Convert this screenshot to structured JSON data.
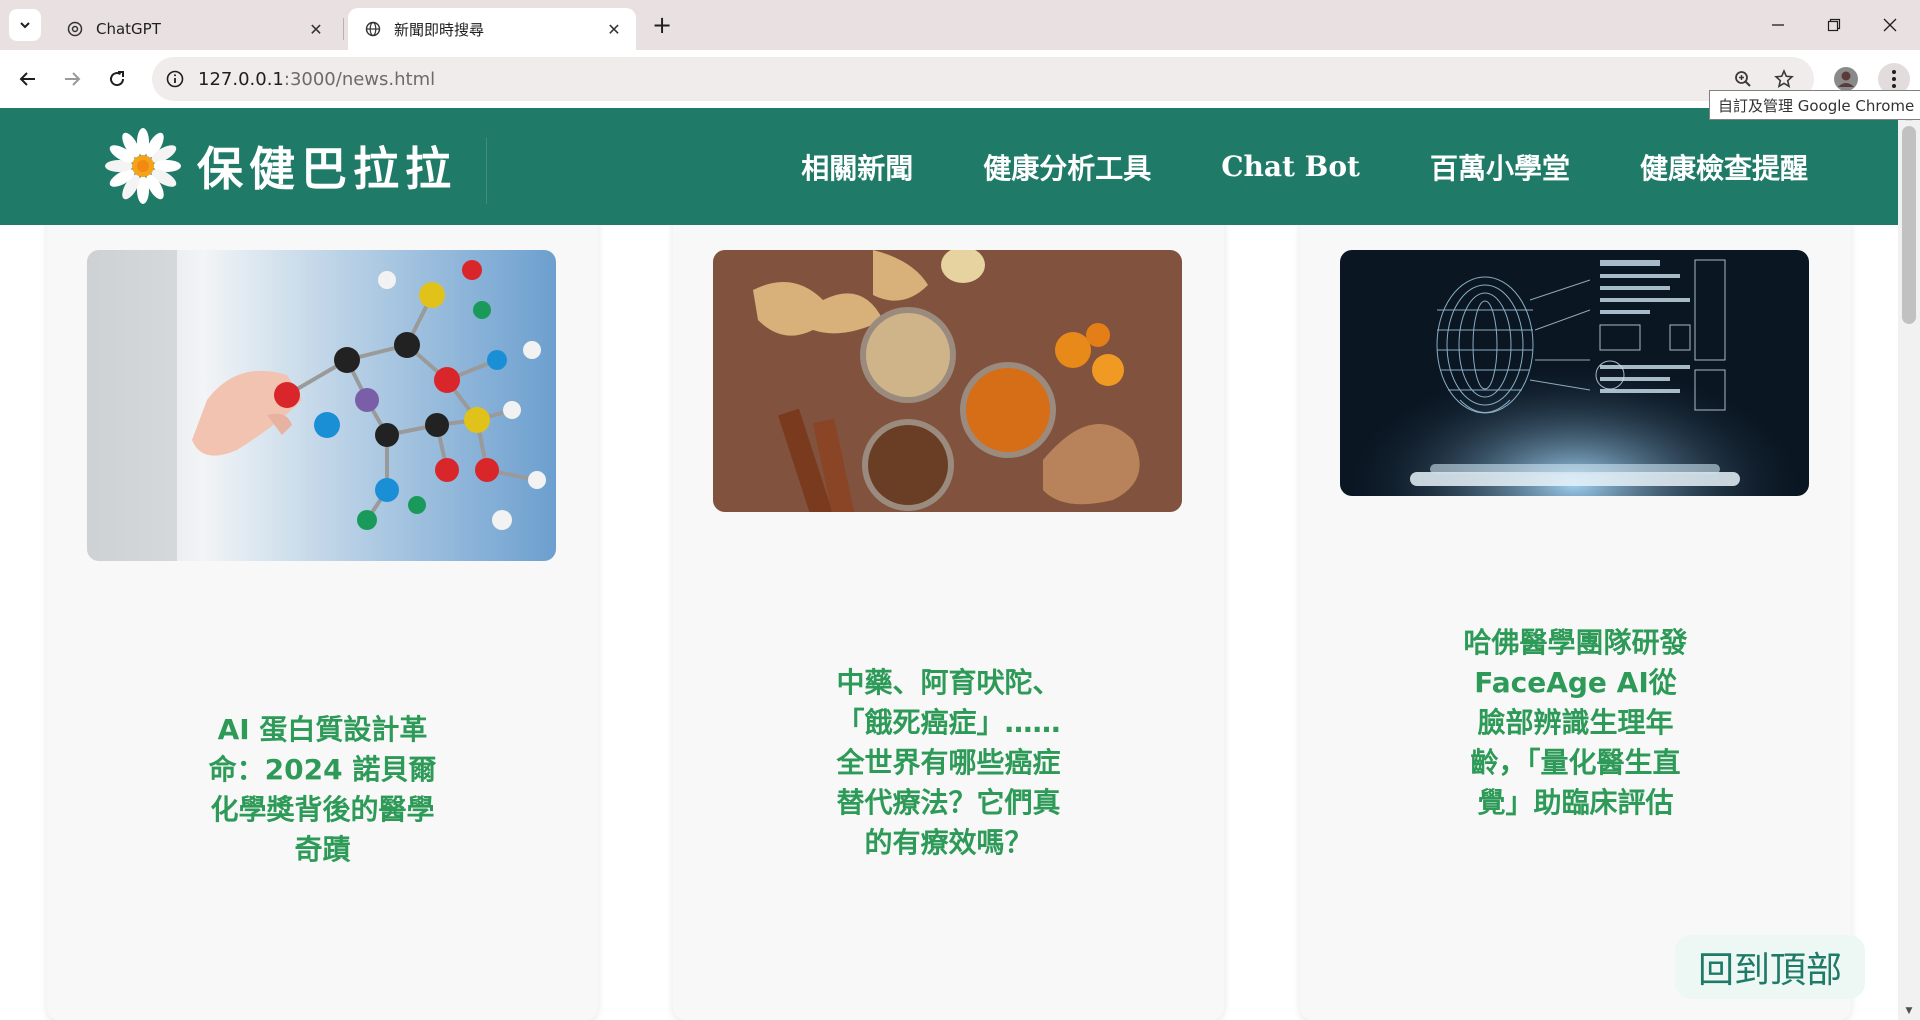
{
  "browser": {
    "tabs": [
      {
        "title": "ChatGPT",
        "icon": "chatgpt-icon",
        "active": false
      },
      {
        "title": "新聞即時搜尋",
        "icon": "globe-icon",
        "active": true
      }
    ],
    "address": {
      "host": "127.0.0.1",
      "path": ":3000/news.html"
    },
    "tooltip": "自訂及管理 Google Chrome"
  },
  "site": {
    "logo_text": "保健巴拉拉",
    "nav": [
      "相關新聞",
      "健康分析工具",
      "Chat Bot",
      "百萬小學堂",
      "健康檢查提醒"
    ]
  },
  "cards": [
    {
      "headline": "AI 蛋白質設計革命：2024 諾貝爾化學獎背後的醫學奇蹟",
      "image": "molecule-model-photo"
    },
    {
      "headline": "中藥、阿育吠陀、「餓死癌症」……全世界有哪些癌症替代療法？它們真的有療效嗎？",
      "image": "spices-photo"
    },
    {
      "headline": "哈佛醫學團隊研發FaceAge AI從臉部辨識生理年齡，「量化醫生直覺」助臨床評估",
      "image": "ai-face-hologram-photo"
    }
  ],
  "back_to_top": "回到頂部",
  "colors": {
    "header": "#1f7a67",
    "headline": "#2d9a58",
    "tabbar": "#e8e0e1"
  }
}
